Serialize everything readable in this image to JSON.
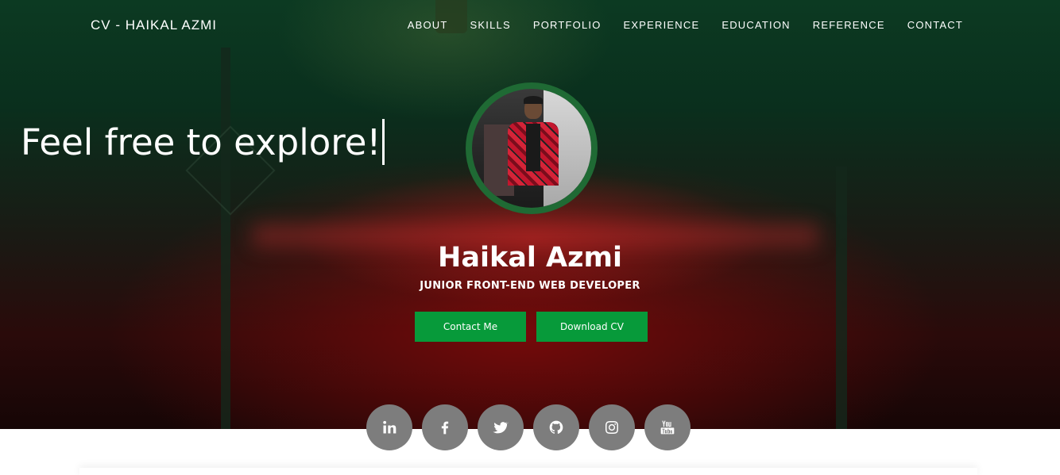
{
  "nav": {
    "brand": "CV - HAIKAL AZMI",
    "items": [
      {
        "label": "ABOUT"
      },
      {
        "label": "SKILLS"
      },
      {
        "label": "PORTFOLIO"
      },
      {
        "label": "EXPERIENCE"
      },
      {
        "label": "EDUCATION"
      },
      {
        "label": "REFERENCE"
      },
      {
        "label": "CONTACT"
      }
    ]
  },
  "hero": {
    "tagline": "Feel free to explore!",
    "name": "Haikal Azmi",
    "role": "JUNIOR FRONT-END WEB DEVELOPER",
    "buttons": {
      "contact": "Contact Me",
      "download": "Download CV"
    }
  },
  "socials": [
    {
      "icon": "linkedin-icon"
    },
    {
      "icon": "facebook-icon"
    },
    {
      "icon": "twitter-icon"
    },
    {
      "icon": "github-icon"
    },
    {
      "icon": "instagram-icon"
    },
    {
      "icon": "youtube-icon"
    }
  ],
  "colors": {
    "accent_green": "#079a3a",
    "avatar_ring": "#1f6a34",
    "social_bg": "#7d7d7d"
  }
}
